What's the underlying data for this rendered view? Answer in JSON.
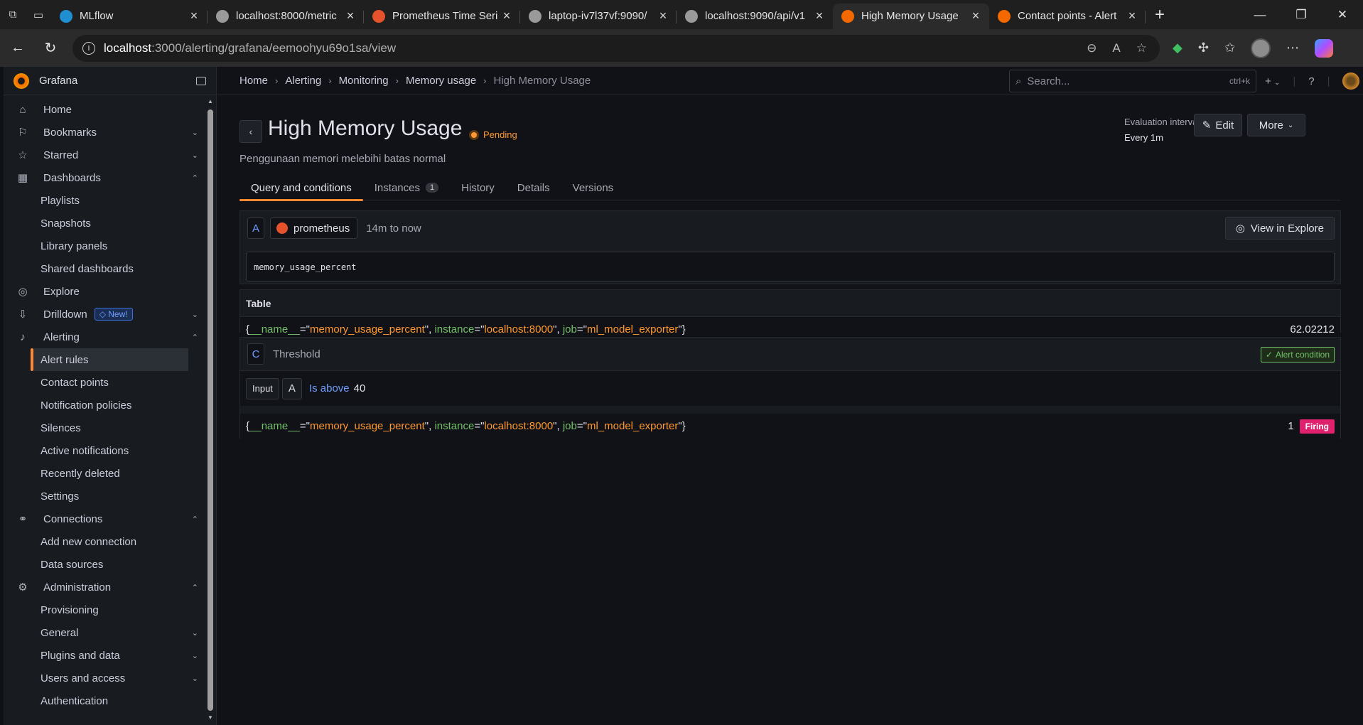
{
  "browser": {
    "tabs": [
      {
        "label": "MLflow",
        "favicon": "mlflow-icon",
        "color": "#1f8fd1"
      },
      {
        "label": "localhost:8000/metric",
        "favicon": "globe-icon",
        "color": "#9a9a9a"
      },
      {
        "label": "Prometheus Time Seri",
        "favicon": "prometheus-icon",
        "color": "#e6522c"
      },
      {
        "label": "laptop-iv7l37vf:9090/",
        "favicon": "globe-icon",
        "color": "#9a9a9a"
      },
      {
        "label": "localhost:9090/api/v1",
        "favicon": "globe-icon",
        "color": "#9a9a9a"
      },
      {
        "label": "High Memory Usage",
        "favicon": "grafana-icon",
        "color": "#f46800"
      },
      {
        "label": "Contact points - Alert",
        "favicon": "grafana-icon",
        "color": "#f46800"
      }
    ],
    "active_tab": 5,
    "url_host": "localhost",
    "url_path": ":3000/alerting/grafana/eemoohyu69o1sa/view"
  },
  "sidebar": {
    "app_name": "Grafana",
    "items": [
      {
        "label": "Home",
        "icon": "home-icon",
        "glyph": "⌂",
        "level": 0
      },
      {
        "label": "Bookmarks",
        "icon": "bookmark-icon",
        "glyph": "⚐",
        "level": 0,
        "chevron": "down"
      },
      {
        "label": "Starred",
        "icon": "star-icon",
        "glyph": "☆",
        "level": 0,
        "chevron": "down"
      },
      {
        "label": "Dashboards",
        "icon": "apps-icon",
        "glyph": "▦",
        "level": 0,
        "chevron": "up"
      },
      {
        "label": "Playlists",
        "level": 1
      },
      {
        "label": "Snapshots",
        "level": 1
      },
      {
        "label": "Library panels",
        "level": 1
      },
      {
        "label": "Shared dashboards",
        "level": 1
      },
      {
        "label": "Explore",
        "icon": "compass-icon",
        "glyph": "◎",
        "level": 0
      },
      {
        "label": "Drilldown",
        "icon": "drilldown-icon",
        "glyph": "⇩",
        "level": 0,
        "chevron": "down",
        "badge": "New!"
      },
      {
        "label": "Alerting",
        "icon": "bell-icon",
        "glyph": "♪",
        "level": 0,
        "chevron": "up"
      },
      {
        "label": "Alert rules",
        "level": 1,
        "active": true
      },
      {
        "label": "Contact points",
        "level": 1
      },
      {
        "label": "Notification policies",
        "level": 1
      },
      {
        "label": "Silences",
        "level": 1
      },
      {
        "label": "Active notifications",
        "level": 1
      },
      {
        "label": "Recently deleted",
        "level": 1
      },
      {
        "label": "Settings",
        "level": 1
      },
      {
        "label": "Connections",
        "icon": "connections-icon",
        "glyph": "⚭",
        "level": 0,
        "chevron": "up"
      },
      {
        "label": "Add new connection",
        "level": 1
      },
      {
        "label": "Data sources",
        "level": 1
      },
      {
        "label": "Administration",
        "icon": "cog-icon",
        "glyph": "⚙",
        "level": 0,
        "chevron": "up"
      },
      {
        "label": "Provisioning",
        "level": 1
      },
      {
        "label": "General",
        "level": 1,
        "chevron": "down"
      },
      {
        "label": "Plugins and data",
        "level": 1,
        "chevron": "down"
      },
      {
        "label": "Users and access",
        "level": 1,
        "chevron": "down"
      },
      {
        "label": "Authentication",
        "level": 1
      }
    ]
  },
  "topbar": {
    "breadcrumbs": [
      "Home",
      "Alerting",
      "Monitoring",
      "Memory usage",
      "High Memory Usage"
    ],
    "search_placeholder": "Search...",
    "search_shortcut": "ctrl+k",
    "add_label": "+"
  },
  "rule": {
    "title": "High Memory Usage",
    "state": "Pending",
    "state_color": "#ff9830",
    "description": "Penggunaan memori melebihi batas normal",
    "eval_label": "Evaluation interval",
    "eval_value": "Every 1m",
    "edit_label": "Edit",
    "more_label": "More"
  },
  "tabs": [
    {
      "label": "Query and conditions",
      "active": true
    },
    {
      "label": "Instances",
      "count": "1"
    },
    {
      "label": "History"
    },
    {
      "label": "Details"
    },
    {
      "label": "Versions"
    }
  ],
  "query": {
    "ref_id": "A",
    "datasource": "prometheus",
    "range": "14m to now",
    "explore_label": "View in Explore",
    "expr": "memory_usage_percent"
  },
  "table": {
    "title": "Table",
    "row": {
      "labels": [
        {
          "key": "__name__",
          "value": "memory_usage_percent"
        },
        {
          "key": "instance",
          "value": "localhost:8000"
        },
        {
          "key": "job",
          "value": "ml_model_exporter"
        }
      ],
      "value": "62.02212"
    }
  },
  "threshold": {
    "ref_id": "C",
    "name": "Threshold",
    "alert_condition_label": "Alert condition",
    "input_label": "Input",
    "input_ref": "A",
    "operator": "Is above",
    "value": "40",
    "result_value": "1",
    "result_state": "Firing",
    "result_color": "#e0226e"
  }
}
